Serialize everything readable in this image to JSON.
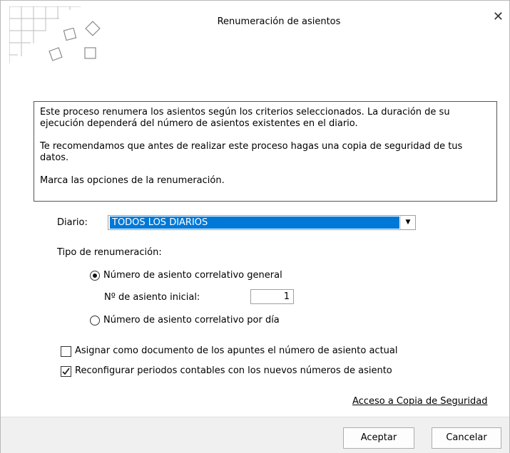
{
  "dialog": {
    "title": "Renumeración de asientos",
    "close_glyph": "✕",
    "info_paragraphs": [
      "Este proceso renumera los asientos según los criterios seleccionados. La duración de su ejecución dependerá del número de asientos existentes en el diario.",
      "Te recomendamos que antes de realizar este proceso hagas una copia de seguridad de tus datos.",
      "Marca las opciones de la renumeración."
    ],
    "diario_label": "Diario:",
    "diario_value": "TODOS LOS DIARIOS",
    "tipo_label": "Tipo de renumeración:",
    "radio_general": {
      "label": "Número de asiento correlativo general",
      "selected": true
    },
    "asiento_inicial_label": "Nº de asiento inicial:",
    "asiento_inicial_value": "1",
    "radio_dia": {
      "label": "Número de asiento correlativo por día",
      "selected": false
    },
    "check_documento": {
      "label": "Asignar como documento de los apuntes el número de asiento actual",
      "checked": false
    },
    "check_periodos": {
      "label": "Reconfigurar periodos contables con los nuevos números de asiento",
      "checked": true
    },
    "backup_link": "Acceso a Copia de Seguridad",
    "accept_label": "Aceptar",
    "cancel_label": "Cancelar",
    "accent_color": "#0078d7"
  }
}
